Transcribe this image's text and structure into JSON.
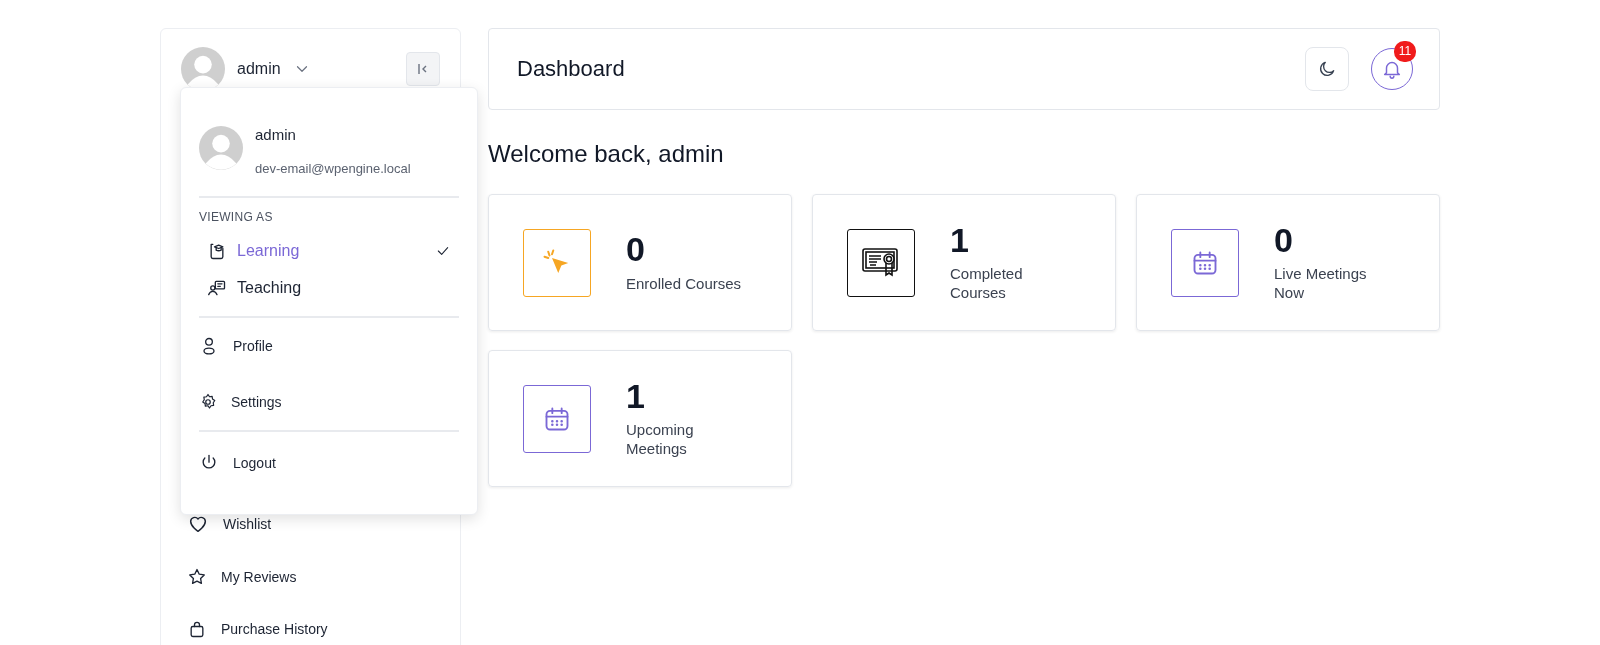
{
  "sidebar": {
    "user": {
      "name": "admin"
    },
    "items": [
      {
        "label": "Wishlist",
        "kind": "heart"
      },
      {
        "label": "My Reviews",
        "kind": "star"
      },
      {
        "label": "Purchase History",
        "kind": "bag"
      }
    ]
  },
  "user_menu": {
    "name": "admin",
    "email": "dev-email@wpengine.local",
    "section_title": "VIEWING AS",
    "roles": [
      {
        "label": "Learning",
        "kind": "learning",
        "selected": true
      },
      {
        "label": "Teaching",
        "kind": "teaching",
        "selected": false
      }
    ],
    "links": [
      {
        "label": "Profile",
        "kind": "user"
      },
      {
        "label": "Settings",
        "kind": "gear"
      }
    ],
    "logout": {
      "label": "Logout"
    }
  },
  "header": {
    "title": "Dashboard",
    "notification_count": "11"
  },
  "welcome": "Welcome back, admin",
  "stats": [
    {
      "value": "0",
      "label": "Enrolled Courses",
      "kind": "cursor",
      "color": "#f6a623"
    },
    {
      "value": "1",
      "label": "Completed Courses",
      "kind": "certificate",
      "color": "#111111"
    },
    {
      "value": "0",
      "label": "Live Meetings Now",
      "kind": "calendar",
      "color": "#7b68d6"
    },
    {
      "value": "1",
      "label": "Upcoming Meetings",
      "kind": "calendar",
      "color": "#7b68d6"
    }
  ]
}
